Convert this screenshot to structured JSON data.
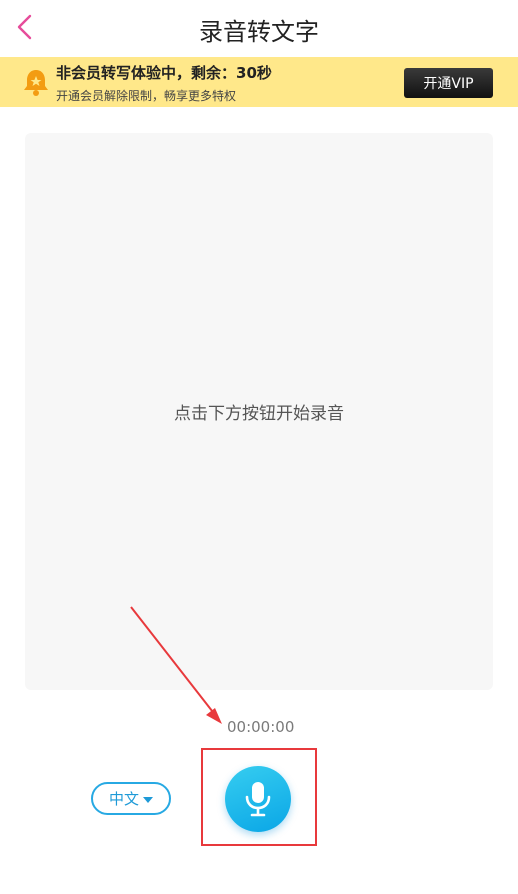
{
  "header": {
    "title": "录音转文字",
    "back_icon": "chevron-left-icon",
    "accent": "#e64c9a"
  },
  "banner": {
    "title": "非会员转写体验中，剩余：30秒",
    "subtitle": "开通会员解除限制，畅享更多特权",
    "vip_button": "开通VIP",
    "bell_icon": "bell-icon",
    "background": "#ffe88a"
  },
  "main": {
    "hint": "点击下方按钮开始录音"
  },
  "recorder": {
    "timer": "00:00:00",
    "language": "中文",
    "mic_icon": "microphone-icon",
    "mic_color": "#1aaee8"
  },
  "annotation": {
    "color": "#e8393c"
  }
}
